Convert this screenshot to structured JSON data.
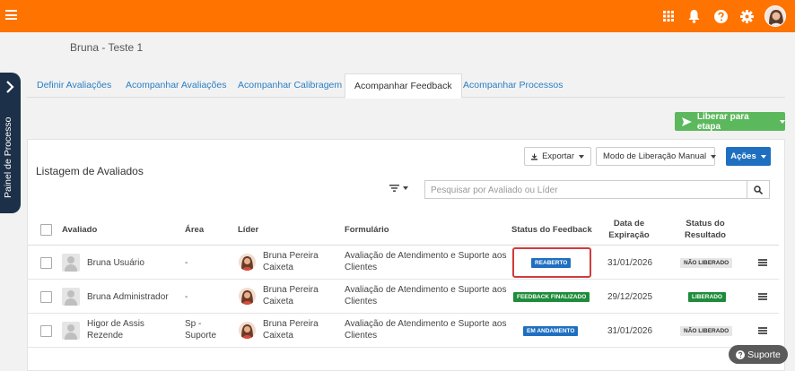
{
  "header": {
    "icons": [
      "menu-icon",
      "apps-grid-icon",
      "bell-icon",
      "help-icon",
      "gear-icon",
      "user-avatar"
    ],
    "accent": "#ff7300"
  },
  "page": {
    "title": "Bruna - Teste 1"
  },
  "side_panel": {
    "label": "Painel de Processo"
  },
  "tabs": [
    {
      "label": "Definir Avaliações",
      "active": false
    },
    {
      "label": "Acompanhar Avaliações",
      "active": false
    },
    {
      "label": "Acompanhar Calibragem",
      "active": false
    },
    {
      "label": "Acompanhar Feedback",
      "active": true
    },
    {
      "label": "Acompanhar Processos",
      "active": false
    }
  ],
  "actions": {
    "release_step": "Liberar para etapa",
    "export": "Exportar",
    "release_mode": "Modo de Liberação Manual",
    "actions": "Ações"
  },
  "list": {
    "title": "Listagem de Avaliados",
    "search_placeholder": "Pesquisar por Avaliado ou Líder",
    "columns": {
      "evaluated": "Avaliado",
      "area": "Área",
      "leader": "Líder",
      "form": "Formulário",
      "feedback_status": "Status do Feedback",
      "expiry_line1": "Data de",
      "expiry_line2": "Expiração",
      "result_line1": "Status do",
      "result_line2": "Resultado"
    },
    "rows": [
      {
        "name": "Bruna Usuário",
        "area": "-",
        "leader": "Bruna Pereira Caixeta",
        "form": "Avaliação de Atendimento e Suporte aos Clientes",
        "feedback_status": "REABERTO",
        "expiry": "31/01/2026",
        "result": "NÃO LIBERADO"
      },
      {
        "name": "Bruna Administrador",
        "area": "-",
        "leader": "Bruna Pereira Caixeta",
        "form": "Avaliação de Atendimento e Suporte aos Clientes",
        "feedback_status": "FEEDBACK FINALIZADO",
        "expiry": "29/12/2025",
        "result": "LIBERADO"
      },
      {
        "name": "Higor de Assis Rezende",
        "area": "Sp - Suporte",
        "leader": "Bruna Pereira Caixeta",
        "form": "Avaliação de Atendimento e Suporte aos Clientes",
        "feedback_status": "EM ANDAMENTO",
        "expiry": "31/01/2026",
        "result": "NÃO LIBERADO"
      }
    ]
  },
  "support": {
    "label": "Suporte"
  }
}
